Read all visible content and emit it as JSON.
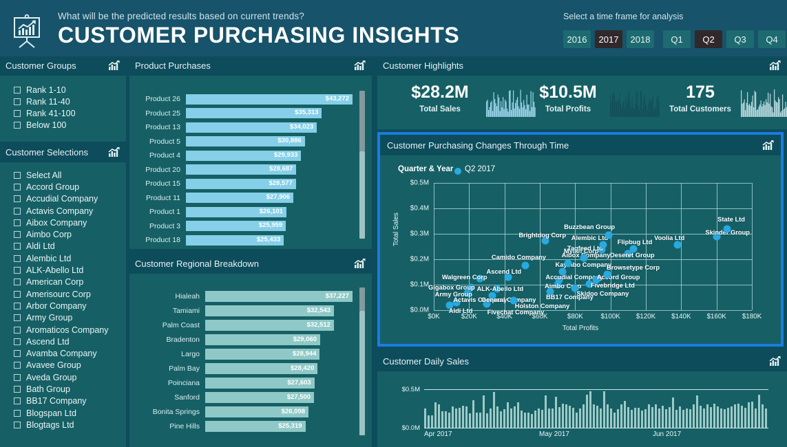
{
  "header": {
    "icon": "presentation-chart-icon",
    "question": "What will be the predicted results based on current trends?",
    "title": "CUSTOMER PURCHASING INSIGHTS",
    "timeframe_label": "Select a time frame for analysis",
    "years": [
      {
        "label": "2016",
        "selected": false
      },
      {
        "label": "2017",
        "selected": true
      },
      {
        "label": "2018",
        "selected": false
      }
    ],
    "quarters": [
      {
        "label": "Q1",
        "selected": false
      },
      {
        "label": "Q2",
        "selected": true
      },
      {
        "label": "Q3",
        "selected": false
      },
      {
        "label": "Q4",
        "selected": false
      }
    ]
  },
  "sidebar": {
    "groups": {
      "title": "Customer Groups",
      "items": [
        {
          "label": "Rank 1-10",
          "checked": false
        },
        {
          "label": "Rank 11-40",
          "checked": false
        },
        {
          "label": "Rank 41-100",
          "checked": false
        },
        {
          "label": "Below 100",
          "checked": false
        }
      ]
    },
    "selections": {
      "title": "Customer Selections",
      "items": [
        {
          "label": "Select All",
          "checked": false
        },
        {
          "label": "Accord Group",
          "checked": false
        },
        {
          "label": "Accudial Company",
          "checked": false
        },
        {
          "label": "Actavis Company",
          "checked": false
        },
        {
          "label": "Aibox Company",
          "checked": false
        },
        {
          "label": "Aimbo Corp",
          "checked": false
        },
        {
          "label": "Aldi Ltd",
          "checked": false
        },
        {
          "label": "Alembic Ltd",
          "checked": false
        },
        {
          "label": "ALK-Abello Ltd",
          "checked": false
        },
        {
          "label": "American Corp",
          "checked": false
        },
        {
          "label": "Amerisourc Corp",
          "checked": false
        },
        {
          "label": "Arbor Company",
          "checked": false
        },
        {
          "label": "Army Group",
          "checked": false
        },
        {
          "label": "Aromaticos Company",
          "checked": false
        },
        {
          "label": "Ascend Ltd",
          "checked": false
        },
        {
          "label": "Avamba Company",
          "checked": false
        },
        {
          "label": "Avavee Group",
          "checked": false
        },
        {
          "label": "Aveda Group",
          "checked": false
        },
        {
          "label": "Bath Group",
          "checked": false
        },
        {
          "label": "BB17 Company",
          "checked": false
        },
        {
          "label": "Blogspan Ltd",
          "checked": false
        },
        {
          "label": "Blogtags Ltd",
          "checked": false
        }
      ]
    }
  },
  "product_purchases": {
    "title": "Product Purchases",
    "icon": "chart-icon"
  },
  "regional_breakdown": {
    "title": "Customer Regional Breakdown",
    "icon": "chart-icon"
  },
  "highlights": {
    "title": "Customer Highlights",
    "icon": "chart-icon",
    "kpis": [
      {
        "value": "$28.2M",
        "label": "Total Sales",
        "spark_color": "#9fd9ee"
      },
      {
        "value": "$10.5M",
        "label": "Total Profits",
        "spark_color": "#134f58"
      },
      {
        "value": "175",
        "label": "Total Customers",
        "spark_color": "#bcdde2"
      }
    ]
  },
  "scatter_panel": {
    "title": "Customer Purchasing Changes Through Time",
    "icon": "chart-icon",
    "legend_label": "Quarter & Year",
    "legend_value": "Q2 2017",
    "highlight_color": "#1b7ce0"
  },
  "daily_sales": {
    "title": "Customer Daily Sales",
    "icon": "chart-icon"
  },
  "chart_data": [
    {
      "type": "bar",
      "title": "Product Purchases",
      "orientation": "horizontal",
      "xlabel": "",
      "ylabel": "",
      "categories": [
        "Product 26",
        "Product 25",
        "Product 13",
        "Product 5",
        "Product 4",
        "Product 20",
        "Product 15",
        "Product 11",
        "Product 1",
        "Product 3",
        "Product 18"
      ],
      "values": [
        43272,
        35313,
        34023,
        30886,
        29933,
        28687,
        28577,
        27906,
        26101,
        25959,
        25433
      ],
      "value_labels": [
        "$43,272",
        "$35,313",
        "$34,023",
        "$30,886",
        "$29,933",
        "$28,687",
        "$28,577",
        "$27,906",
        "$26,101",
        "$25,959",
        "$25,433"
      ],
      "bar_color": "#85cfe8",
      "xlim": [
        0,
        43272
      ]
    },
    {
      "type": "bar",
      "title": "Customer Regional Breakdown",
      "orientation": "horizontal",
      "xlabel": "",
      "ylabel": "",
      "categories": [
        "Hialeah",
        "Tamiami",
        "Palm Coast",
        "Bradenton",
        "Largo",
        "Palm Bay",
        "Poinciana",
        "Sanford",
        "Bonita Springs",
        "Pine Hills"
      ],
      "values": [
        37227,
        32543,
        32512,
        29060,
        28944,
        28420,
        27603,
        27500,
        26098,
        25319
      ],
      "value_labels": [
        "$37,227",
        "$32,543",
        "$32,512",
        "$29,060",
        "$28,944",
        "$28,420",
        "$27,603",
        "$27,500",
        "$26,098",
        "$25,319"
      ],
      "bar_color": "#8fc9c7",
      "xlim": [
        0,
        37227
      ]
    },
    {
      "type": "scatter",
      "title": "Customer Purchasing Changes Through Time",
      "xlabel": "Total Profits",
      "ylabel": "Total Sales",
      "legend": [
        "Q2 2017"
      ],
      "legend_position": "top-left",
      "grid": true,
      "xlim": [
        0,
        180000
      ],
      "ylim": [
        0,
        500000
      ],
      "xticks": [
        "$0K",
        "$20K",
        "$40K",
        "$60K",
        "$80K",
        "$100K",
        "$120K",
        "$140K",
        "$160K",
        "$180K"
      ],
      "yticks": [
        "$0.0M",
        "$0.1M",
        "$0.2M",
        "$0.3M",
        "$0.4M",
        "$0.5M"
      ],
      "point_color": "#29a9e0",
      "points": [
        {
          "label": "Aldi Ltd",
          "x": 9000,
          "y": 18000
        },
        {
          "label": "Actavis Company",
          "x": 13000,
          "y": 30000
        },
        {
          "label": "Army Group",
          "x": 19000,
          "y": 68000
        },
        {
          "label": "Gigabox Group",
          "x": 21000,
          "y": 88000
        },
        {
          "label": "Walgreen Corp",
          "x": 26000,
          "y": 123000
        },
        {
          "label": "Fivechat Company",
          "x": 30000,
          "y": 24000
        },
        {
          "label": "General Company",
          "x": 33000,
          "y": 57000
        },
        {
          "label": "ALK-Abello Ltd",
          "x": 36000,
          "y": 84000
        },
        {
          "label": "Ascend Ltd",
          "x": 42000,
          "y": 130000
        },
        {
          "label": "Holston Company",
          "x": 45000,
          "y": 38000
        },
        {
          "label": "Camido Company",
          "x": 52000,
          "y": 175000
        },
        {
          "label": "Brightdog Corp",
          "x": 63000,
          "y": 272000
        },
        {
          "label": "BB17 Company",
          "x": 66000,
          "y": 73000
        },
        {
          "label": "Aimbo Corp",
          "x": 70000,
          "y": 100000
        },
        {
          "label": "Accudial Company",
          "x": 71000,
          "y": 120000
        },
        {
          "label": "Kaymbo Company",
          "x": 73000,
          "y": 152000
        },
        {
          "label": "Aibox Company",
          "x": 76000,
          "y": 185000
        },
        {
          "label": "Skidoo Company",
          "x": 80000,
          "y": 86000
        },
        {
          "label": "Mylan Corp",
          "x": 85000,
          "y": 205000
        },
        {
          "label": "Fivebridge Ltd",
          "x": 88000,
          "y": 102000
        },
        {
          "label": "Accord Group",
          "x": 92000,
          "y": 118000
        },
        {
          "label": "Tagfeed Ltd",
          "x": 95000,
          "y": 238000
        },
        {
          "label": "Alembic Ltd",
          "x": 96000,
          "y": 258000
        },
        {
          "label": "Browsetype Corp",
          "x": 98000,
          "y": 140000
        },
        {
          "label": "Buzzbean Group",
          "x": 99000,
          "y": 295000
        },
        {
          "label": "Deseret Group",
          "x": 110000,
          "y": 222000
        },
        {
          "label": "Flipbug Ltd",
          "x": 113000,
          "y": 240000
        },
        {
          "label": "Voolia Ltd",
          "x": 138000,
          "y": 258000
        },
        {
          "label": "Skinder Group",
          "x": 160000,
          "y": 290000
        },
        {
          "label": "State Ltd",
          "x": 166000,
          "y": 320000
        }
      ]
    },
    {
      "type": "bar",
      "title": "Customer Daily Sales",
      "xlabel": "",
      "ylabel": "",
      "yticks": [
        "$0.0M",
        "$0.5M"
      ],
      "ylim": [
        0,
        500000
      ],
      "xticks": [
        "Apr 2017",
        "May 2017",
        "Jun 2017"
      ],
      "bar_color": "#9ecac7",
      "values": [
        250,
        160,
        165,
        330,
        300,
        210,
        215,
        200,
        280,
        250,
        255,
        290,
        280,
        190,
        360,
        200,
        200,
        420,
        190,
        250,
        460,
        280,
        210,
        240,
        330,
        250,
        280,
        330,
        220,
        195,
        200,
        180,
        220,
        250,
        230,
        420,
        250,
        250,
        400,
        270,
        310,
        300,
        290,
        260,
        200,
        250,
        300,
        430,
        470,
        300,
        290,
        250,
        470,
        300,
        250,
        200,
        240,
        300,
        350,
        270,
        230,
        260,
        260,
        220,
        240,
        300,
        270,
        300,
        250,
        290,
        240,
        270,
        390,
        230,
        280,
        230,
        250,
        240,
        300,
        420,
        290,
        250,
        300,
        270,
        310,
        280,
        250,
        240,
        260,
        280,
        300,
        310,
        290,
        260,
        330,
        340,
        250,
        430,
        300,
        250
      ]
    }
  ]
}
